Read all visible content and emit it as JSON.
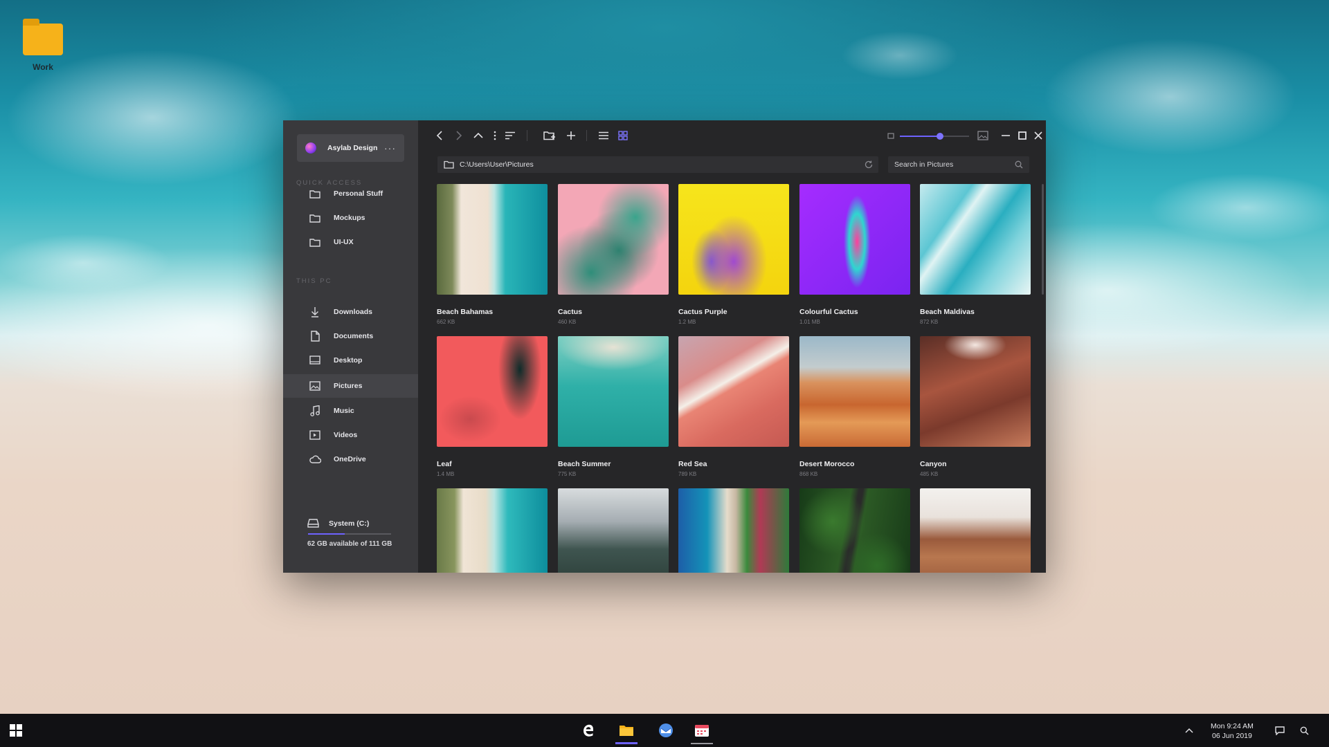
{
  "desktop": {
    "icons": [
      {
        "label": "Work",
        "icon": "folder-icon"
      }
    ]
  },
  "explorer": {
    "account": {
      "name": "Asylab Design",
      "more": "···"
    },
    "sections": {
      "quick_access": "QUICK ACCESS",
      "this_pc": "THIS PC"
    },
    "quick_access": [
      {
        "label": "Personal Stuff",
        "icon": "folder-icon"
      },
      {
        "label": "Mockups",
        "icon": "folder-icon"
      },
      {
        "label": "UI-UX",
        "icon": "folder-icon"
      }
    ],
    "this_pc": [
      {
        "label": "Downloads",
        "icon": "download-icon"
      },
      {
        "label": "Documents",
        "icon": "document-icon"
      },
      {
        "label": "Desktop",
        "icon": "desktop-icon"
      },
      {
        "label": "Pictures",
        "icon": "pictures-icon",
        "active": true
      },
      {
        "label": "Music",
        "icon": "music-icon"
      },
      {
        "label": "Videos",
        "icon": "video-icon"
      },
      {
        "label": "OneDrive",
        "icon": "cloud-icon"
      }
    ],
    "storage": {
      "name": "System (C:)",
      "available": "62 GB available of 111 GB",
      "used_fraction": 0.44
    },
    "address": {
      "path": "C:\\Users\\User\\Pictures"
    },
    "search": {
      "placeholder": "Search in Pictures"
    },
    "zoom": {
      "level": 0.58
    },
    "view_mode": "grid",
    "accent": "#6e63ff",
    "files": [
      {
        "name": "Beach Bahamas",
        "size": "662 KB",
        "thumb": "t-beach"
      },
      {
        "name": "Cactus",
        "size": "460 KB",
        "thumb": "t-cactus"
      },
      {
        "name": "Cactus Purple",
        "size": "1.2 MB",
        "thumb": "t-cactus-purple"
      },
      {
        "name": "Colourful Cactus",
        "size": "1.01 MB",
        "thumb": "t-colourful"
      },
      {
        "name": "Beach Maldivas",
        "size": "872 KB",
        "thumb": "t-maldivas"
      },
      {
        "name": "Leaf",
        "size": "1.4 MB",
        "thumb": "t-leaf"
      },
      {
        "name": "Beach Summer",
        "size": "775 KB",
        "thumb": "t-summer"
      },
      {
        "name": "Red Sea",
        "size": "789 KB",
        "thumb": "t-redsea"
      },
      {
        "name": "Desert Morocco",
        "size": "868 KB",
        "thumb": "t-desert"
      },
      {
        "name": "Canyon",
        "size": "485 KB",
        "thumb": "t-canyon"
      },
      {
        "name": "",
        "size": "",
        "thumb": "t-beach2"
      },
      {
        "name": "",
        "size": "",
        "thumb": "t-forest"
      },
      {
        "name": "",
        "size": "",
        "thumb": "t-coast"
      },
      {
        "name": "",
        "size": "",
        "thumb": "t-road"
      },
      {
        "name": "",
        "size": "",
        "thumb": "t-mountain"
      }
    ]
  },
  "taskbar": {
    "apps": [
      {
        "name": "edge",
        "icon": "edge-icon",
        "state": "idle"
      },
      {
        "name": "file-explorer",
        "icon": "folder-icon",
        "state": "active"
      },
      {
        "name": "mail",
        "icon": "mail-icon",
        "state": "idle"
      },
      {
        "name": "calendar",
        "icon": "calendar-icon",
        "state": "open"
      }
    ],
    "clock": {
      "time": "Mon 9:24 AM",
      "date": "06 Jun 2019"
    }
  }
}
